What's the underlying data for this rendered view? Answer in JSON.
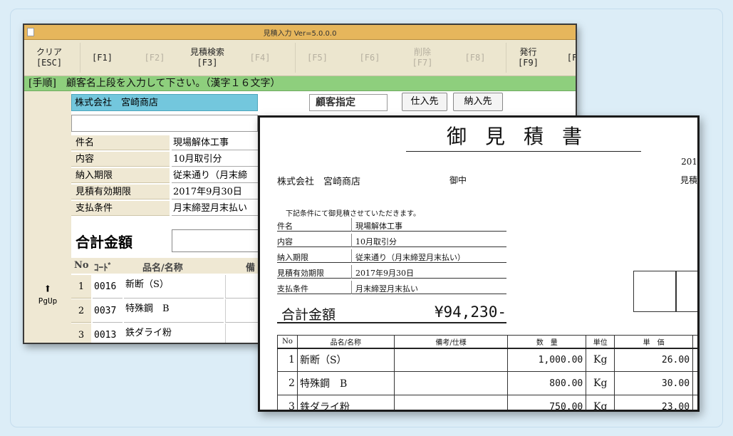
{
  "app": {
    "title": "見積入力 Ver=5.0.0.0",
    "fkeys": [
      {
        "l1": "クリア",
        "l2": "[ESC]",
        "disabled": false
      },
      {
        "l1": "",
        "l2": "[F1]",
        "disabled": false
      },
      {
        "l1": "",
        "l2": "[F2]",
        "disabled": true
      },
      {
        "l1": "見積検索",
        "l2": "[F3]",
        "disabled": false
      },
      {
        "l1": "",
        "l2": "[F4]",
        "disabled": true
      },
      {
        "l1": "",
        "l2": "[F5]",
        "disabled": true
      },
      {
        "l1": "",
        "l2": "[F6]",
        "disabled": true
      },
      {
        "l1": "削除",
        "l2": "[F7]",
        "disabled": true
      },
      {
        "l1": "",
        "l2": "[F8]",
        "disabled": true
      },
      {
        "l1": "発行",
        "l2": "[F9]",
        "disabled": false
      },
      {
        "l1": "",
        "l2": "[F",
        "disabled": false
      }
    ],
    "instruction": "[手順]　顧客名上段を入力して下さい。（漢字１６文字）",
    "customer_name": "株式会社　宮崎商店",
    "customer_label": "顧客指定",
    "supplier_btn": "仕入先",
    "delivery_btn": "納入先",
    "fields": [
      {
        "label": "件名",
        "value": "現場解体工事"
      },
      {
        "label": "内容",
        "value": "10月取引分"
      },
      {
        "label": "納入期限",
        "value": "従来通り（月末締"
      },
      {
        "label": "見積有効期限",
        "value": "2017年9月30日"
      },
      {
        "label": "支払条件",
        "value": "月末締翌月末払い"
      }
    ],
    "total_label": "合計金額",
    "grid_headers": {
      "no": "No",
      "code": "ｺｰﾄﾞ",
      "name": "品名/名称",
      "note": "備"
    },
    "rows": [
      {
        "no": "1",
        "code": "0016",
        "name": "新断（S）"
      },
      {
        "no": "2",
        "code": "0037",
        "name": "特殊鋼　B"
      },
      {
        "no": "3",
        "code": "0013",
        "name": "鉄ダライ粉"
      }
    ],
    "pgup": "PgUp"
  },
  "doc": {
    "title": "御見積書",
    "date_fragment": "201",
    "customer": "株式会社　宮崎商店",
    "onchu": "御中",
    "estno_fragment": "見積",
    "intro": "下記条件にて御見積させていただきます。",
    "fields": [
      {
        "label": "件名",
        "value": "現場解体工事"
      },
      {
        "label": "内容",
        "value": "10月取引分"
      },
      {
        "label": "納入期限",
        "value": "従来通り（月末締翌月末払い）"
      },
      {
        "label": "見積有効期限",
        "value": "2017年9月30日"
      },
      {
        "label": "支払条件",
        "value": "月末締翌月末払い"
      }
    ],
    "total_label": "合計金額",
    "total_value": "¥94,230-",
    "table_headers": {
      "no": "No",
      "name": "品名/名称",
      "note": "備考/仕様",
      "qty": "数　量",
      "unit": "単位",
      "price": "単　価"
    },
    "rows": [
      {
        "no": "1",
        "name": "新断（S）",
        "qty": "1,000.00",
        "unit": "Kg",
        "price": "26.00"
      },
      {
        "no": "2",
        "name": "特殊鋼　B",
        "qty": "800.00",
        "unit": "Kg",
        "price": "30.00"
      },
      {
        "no": "3",
        "name": "鉄ダライ粉",
        "qty": "750.00",
        "unit": "Kg",
        "price": "23.00"
      }
    ]
  }
}
